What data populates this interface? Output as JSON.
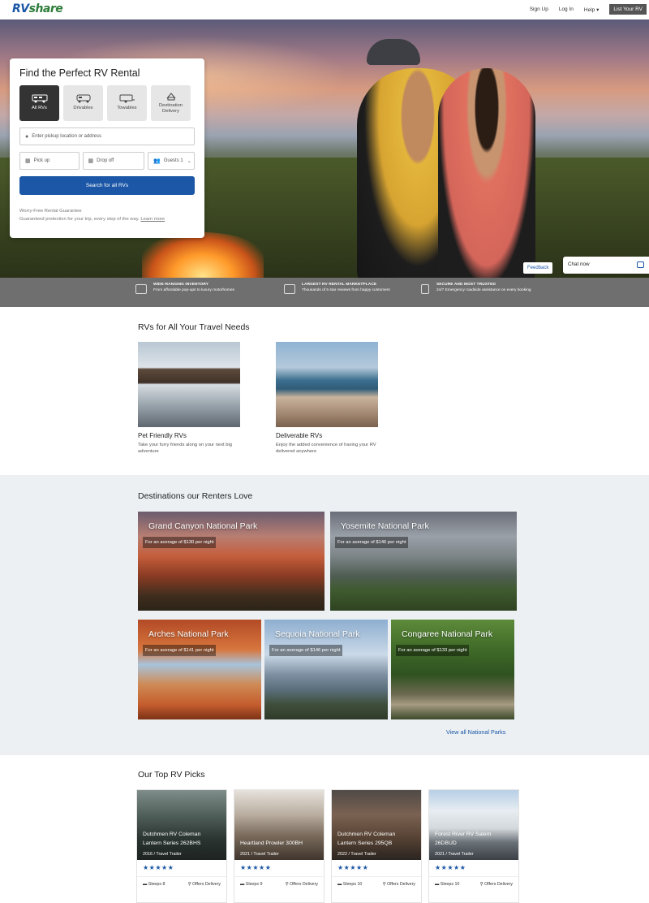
{
  "nav": {
    "logo_a": "RV",
    "logo_b": "share",
    "signup": "Sign Up",
    "login": "Log In",
    "help": "Help ▾",
    "list": "List Your RV"
  },
  "search": {
    "title": "Find the Perfect RV Rental",
    "types": [
      {
        "label": "All RVs",
        "icon": "motorhome-icon"
      },
      {
        "label": "Drivables",
        "icon": "drivable-icon"
      },
      {
        "label": "Towables",
        "icon": "trailer-icon"
      },
      {
        "label": "Destination Delivery",
        "icon": "delivery-icon"
      }
    ],
    "location_placeholder": "Enter pickup location or address",
    "pickup": "Pick up",
    "dropoff": "Drop off",
    "guests_label": "Guests",
    "guests_value": "1",
    "button": "Search for all RVs",
    "guarantee_title": "Worry-Free Rental Guarantee",
    "guarantee_text": "Guaranteed protection for your trip, every step of the way.",
    "learn_more": "Learn more"
  },
  "feedback": "Feedback",
  "chat": "Chat now",
  "features": [
    {
      "title": "WIDE-RANGING INVENTORY",
      "text": "From affordable pop-ups to luxury motorhomes"
    },
    {
      "title": "LARGEST RV RENTAL MARKETPLACE",
      "text": "Thousands of 5 star reviews from happy customers"
    },
    {
      "title": "SECURE AND MOST TRUSTED",
      "text": "24/7 Emergency roadside assistance on every booking"
    }
  ],
  "travel": {
    "title": "RVs for All Your Travel Needs",
    "cards": [
      {
        "title": "Pet Friendly RVs",
        "desc": "Take your furry friends along on your next big adventure"
      },
      {
        "title": "Deliverable RVs",
        "desc": "Enjoy the added convenience of having your RV delivered anywhere"
      }
    ]
  },
  "destinations": {
    "title": "Destinations our Renters Love",
    "items": [
      {
        "name": "Grand Canyon National Park",
        "price": "For an average of $130 per night"
      },
      {
        "name": "Yosemite National Park",
        "price": "For an average of $146 per night"
      },
      {
        "name": "Arches National Park",
        "price": "For an average of $141 per night"
      },
      {
        "name": "Sequoia National Park",
        "price": "For an average of $146 per night"
      },
      {
        "name": "Congaree National Park",
        "price": "For an average of $133 per night"
      }
    ],
    "view_all": "View all National Parks"
  },
  "picks": {
    "title": "Our Top RV Picks",
    "items": [
      {
        "name1": "Dutchmen RV Coleman",
        "name2": "Lantern Series 262BHS",
        "year": "2016 / Travel Trailer",
        "stars": "★★★★★",
        "sleeps": "Sleeps 8",
        "delivery": "Offers Delivery"
      },
      {
        "name1": "Heartland Prowler 300BH",
        "name2": "",
        "year": "2021 / Travel Trailer",
        "stars": "★★★★★",
        "sleeps": "Sleeps 9",
        "delivery": "Offers Delivery"
      },
      {
        "name1": "Dutchmen RV Coleman",
        "name2": "Lantern Series 295QB",
        "year": "2022 / Travel Trailer",
        "stars": "★★★★★",
        "sleeps": "Sleeps 10",
        "delivery": "Offers Delivery"
      },
      {
        "name1": "Forest River RV Salem",
        "name2": "26DBUD",
        "year": "2021 / Travel Trailer",
        "stars": "★★★★★",
        "sleeps": "Sleeps 10",
        "delivery": "Offers Delivery"
      }
    ]
  }
}
